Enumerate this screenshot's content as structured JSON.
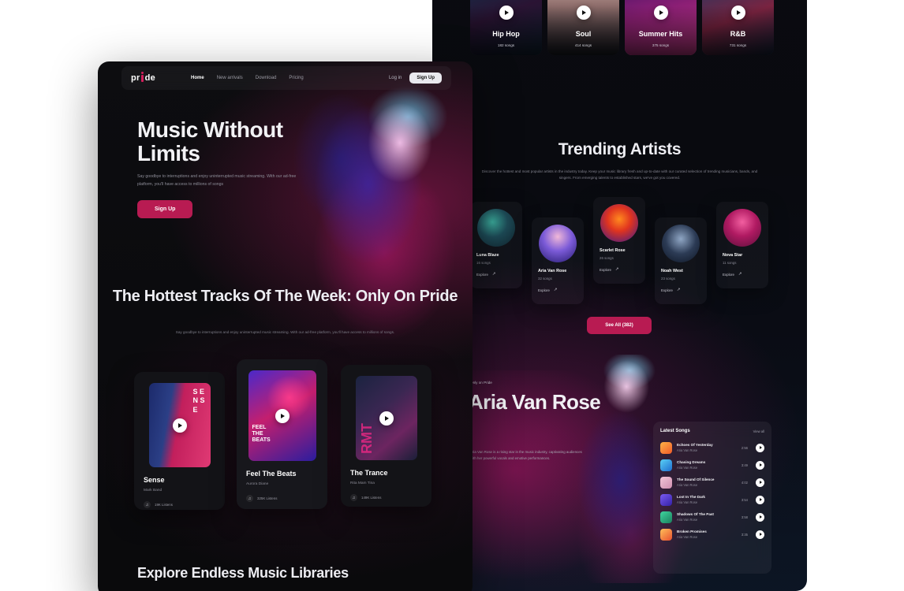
{
  "brand": {
    "name": "pride",
    "name_prefix": "pr",
    "name_suffix": "de"
  },
  "nav": {
    "links": [
      {
        "label": "Home",
        "active": true
      },
      {
        "label": "New arrivals",
        "active": false
      },
      {
        "label": "Download",
        "active": false
      },
      {
        "label": "Pricing",
        "active": false
      }
    ],
    "login_label": "Log in",
    "signup_label": "Sign Up"
  },
  "hero": {
    "title": "Music Without Limits",
    "subtitle": "Say goodbye to interruptions and enjoy uninterrupted music streaming. With our ad-free platform, you'll have access to millions of songs",
    "cta_label": "Sign Up"
  },
  "hottest": {
    "title": "The Hottest Tracks Of The Week: Only On Pride",
    "subtitle": "Say goodbye to interruptions and enjoy uninterrupted music streaming. With our ad-free platform, you'll have access to millions of songs.",
    "tracks": [
      {
        "name": "Sense",
        "artist": "Mark Band",
        "listens": "19K Listens",
        "cover_text": "S E N S E"
      },
      {
        "name": "Feel The Beats",
        "artist": "Aurora Diane",
        "listens": "325K Listens",
        "cover_text": "FEEL THE BEATS"
      },
      {
        "name": "The Trance",
        "artist": "Rita Mam Tina",
        "listens": "149K Listens",
        "cover_text": "RMT"
      }
    ]
  },
  "explore": {
    "title": "Explore Endless Music Libraries"
  },
  "categories": [
    {
      "name": "Hip Hop",
      "count": "182 songs"
    },
    {
      "name": "Soul",
      "count": "414 songs"
    },
    {
      "name": "Summer Hits",
      "count": "375 songs"
    },
    {
      "name": "R&B",
      "count": "731 songs"
    }
  ],
  "trending": {
    "title": "Trending Artists",
    "subtitle": "Discover the hottest and most popular artists in the industry today. Keep your music library fresh and up-to-date with our curated selection of trending musicians, bands, and singers. From emerging talents to established stars, we've got you covered.",
    "explore_label": "Explore",
    "see_all_label": "See All (382)",
    "artists": [
      {
        "name": "Luna Blaze",
        "songs": "16 songs"
      },
      {
        "name": "Aria Van Rose",
        "songs": "32 songs"
      },
      {
        "name": "Scarlet Rose",
        "songs": "26 songs"
      },
      {
        "name": "Noah West",
        "songs": "23 songs"
      },
      {
        "name": "Nova Star",
        "songs": "11 songs"
      }
    ]
  },
  "feature": {
    "eyebrow": "Only on Pride",
    "title": "Aria Van Rose",
    "description": "Aria Van Rose is a rising star in the music industry, captivating audiences with her powerful vocals and emotive performances."
  },
  "latest_songs": {
    "title": "Latest Songs",
    "view_all_label": "View all",
    "items": [
      {
        "name": "Echoes Of Yesterday",
        "artist": "Aria Van Rose",
        "time": "2:56"
      },
      {
        "name": "Chasing Dreams",
        "artist": "Aria Van Rose",
        "time": "3:49"
      },
      {
        "name": "The Sound Of Silence",
        "artist": "Aria Van Rose",
        "time": "4:02"
      },
      {
        "name": "Lost In The Dark",
        "artist": "Aria Van Rose",
        "time": "3:54"
      },
      {
        "name": "Shadows Of The Past",
        "artist": "Aria Van Rose",
        "time": "3:58"
      },
      {
        "name": "Broken Promises",
        "artist": "Aria Van Rose",
        "time": "3:35"
      }
    ]
  },
  "colors": {
    "accent": "#b81b52",
    "logo_accent": "#d41f5c",
    "background": "#ffffff",
    "panel": "#0a0a0c"
  }
}
